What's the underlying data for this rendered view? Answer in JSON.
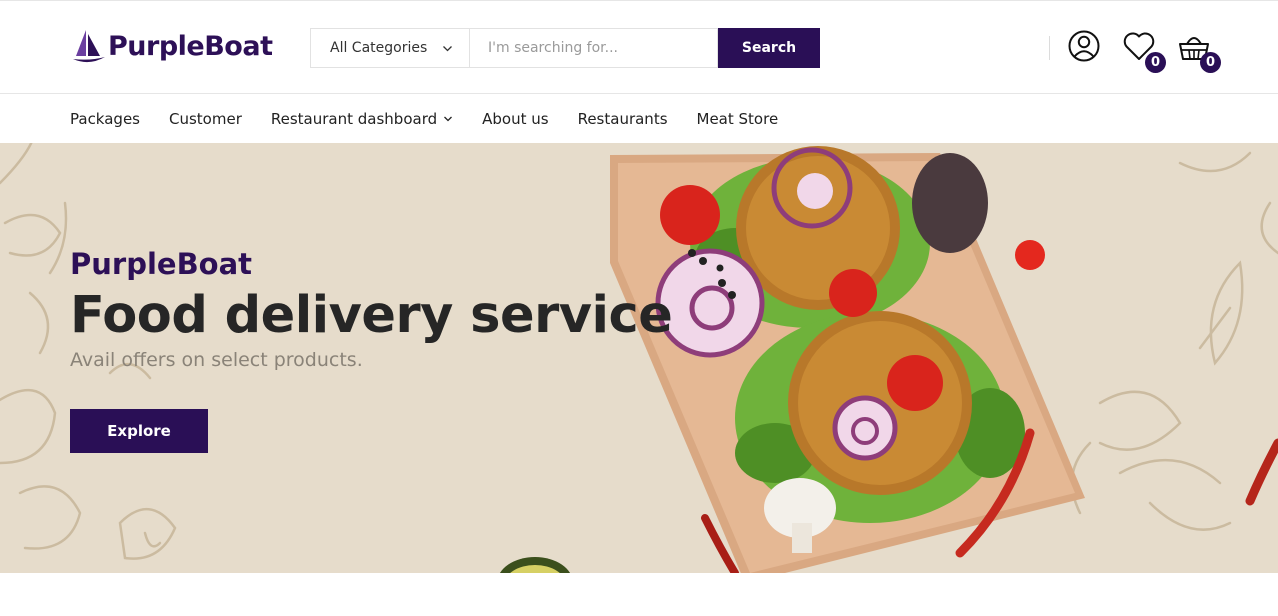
{
  "brand": {
    "name": "PurpleBoat",
    "logo_icon": "boat-logo-icon"
  },
  "search": {
    "category_value": "All Categories",
    "placeholder": "I'm searching for...",
    "value": "",
    "button_label": "Search"
  },
  "header_actions": {
    "account_icon": "user-circle-icon",
    "wishlist_icon": "heart-icon",
    "wishlist_count": "0",
    "cart_icon": "basket-icon",
    "cart_count": "0"
  },
  "nav": {
    "items": [
      {
        "label": "Packages"
      },
      {
        "label": "Customer"
      },
      {
        "label": "Restaurant dashboard",
        "has_dropdown": true
      },
      {
        "label": "About us"
      },
      {
        "label": "Restaurants"
      },
      {
        "label": "Meat Store"
      }
    ]
  },
  "hero": {
    "eyebrow": "PurpleBoat",
    "title": "Food delivery service",
    "subtitle": "Avail offers on select products.",
    "button_label": "Explore"
  },
  "colors": {
    "brand": "#2a0f56",
    "hero_background": "#e6dccb",
    "text_dark": "#262626",
    "text_muted": "#8a8378"
  }
}
